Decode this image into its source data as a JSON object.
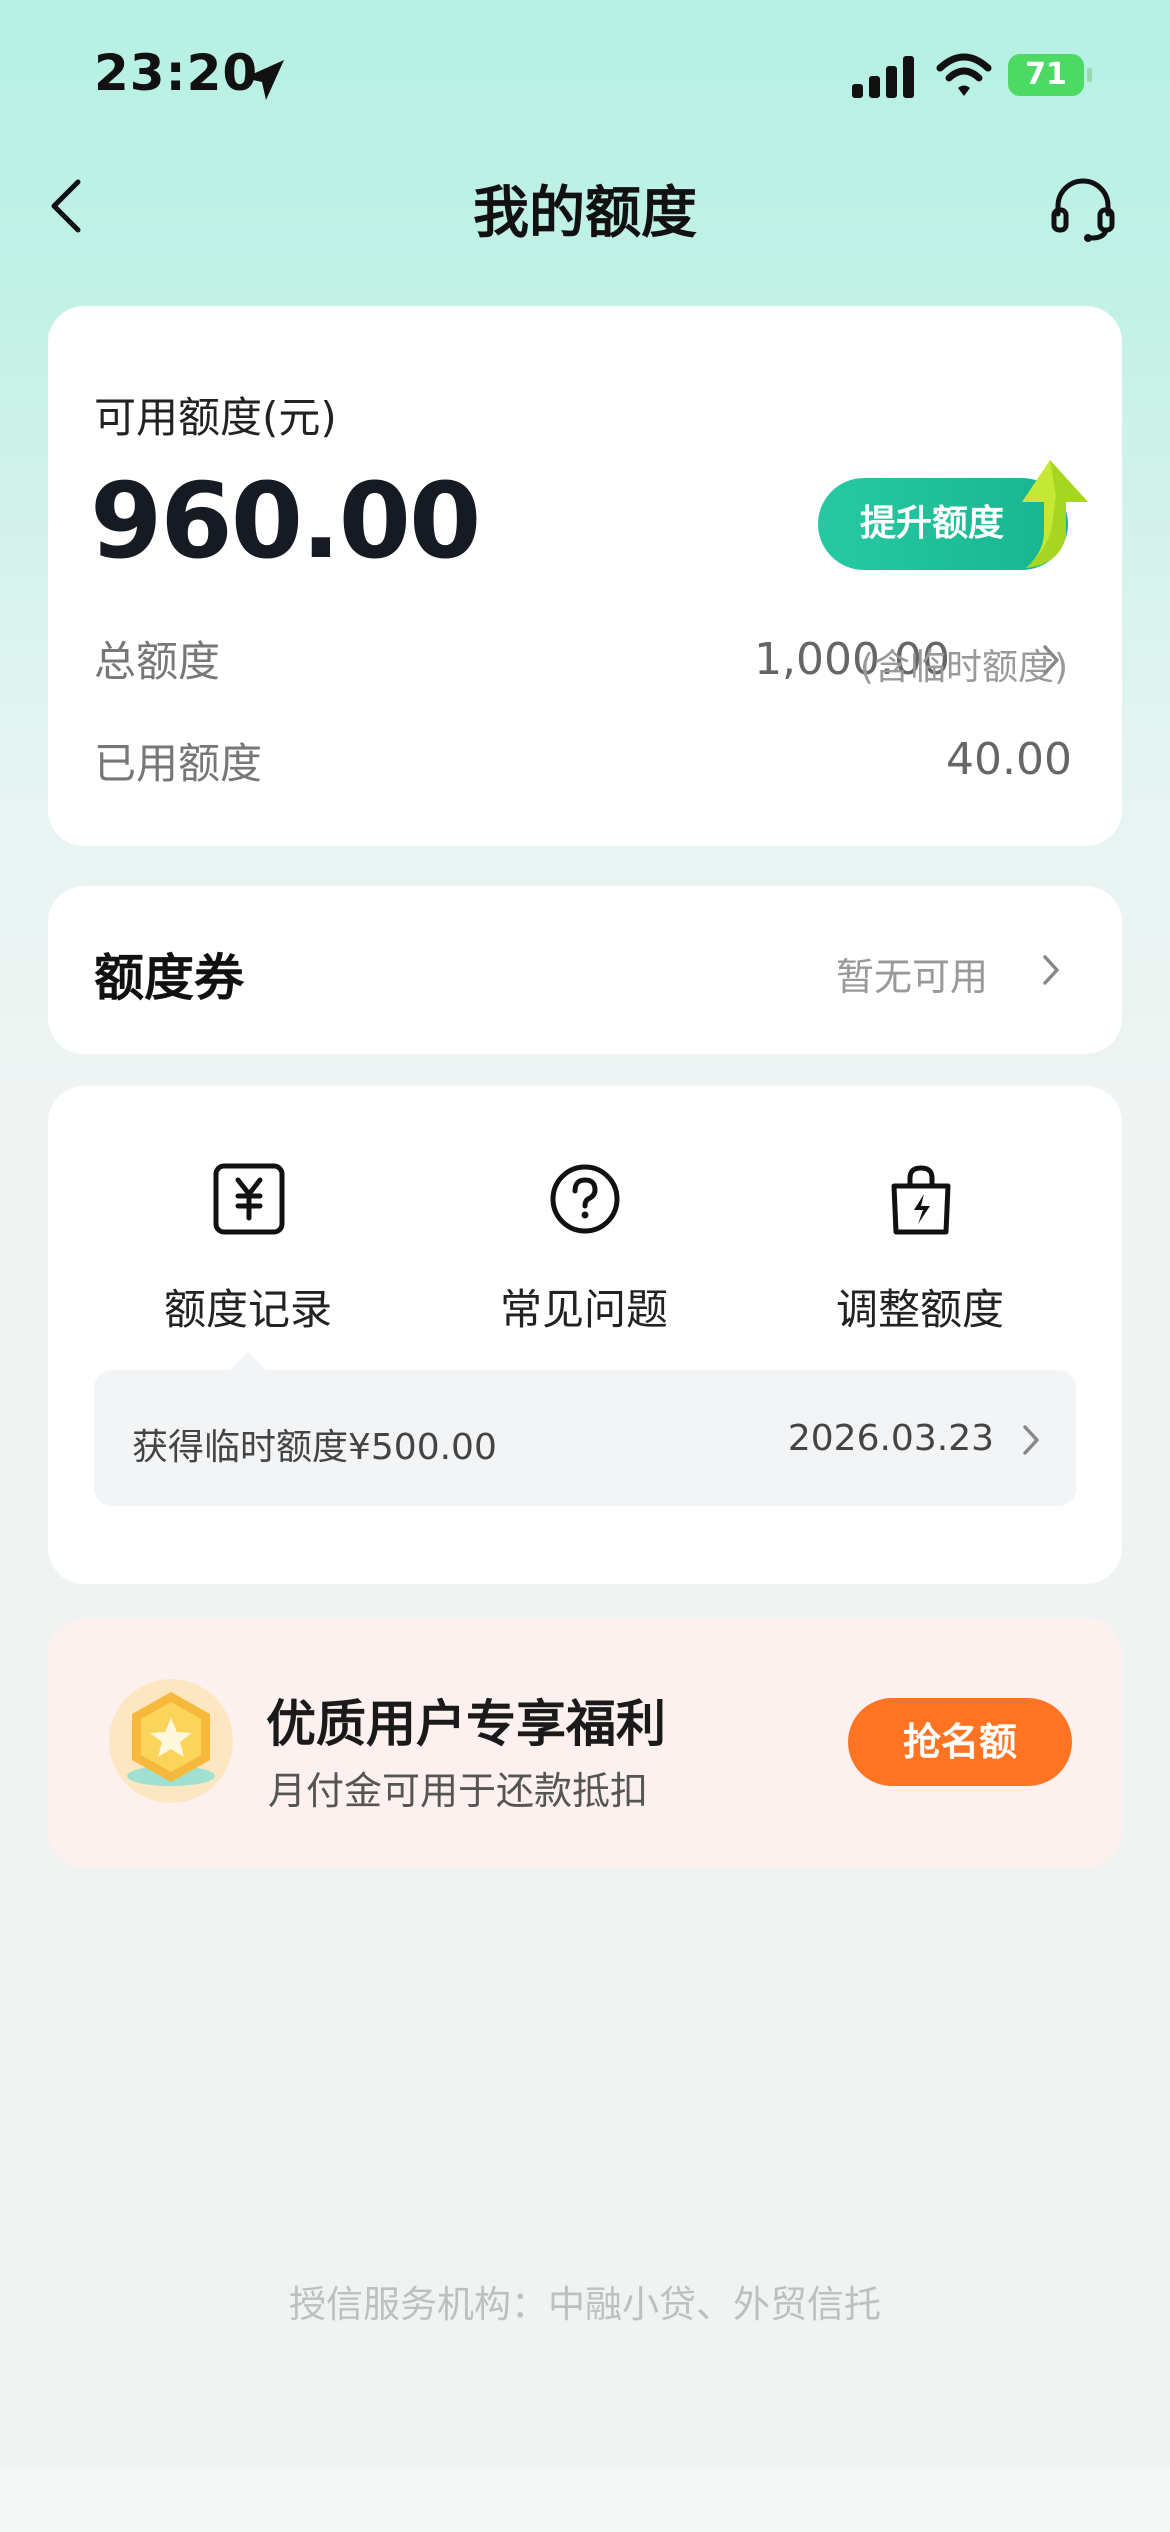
{
  "status_bar": {
    "time": "23:20",
    "battery": "71"
  },
  "nav": {
    "title": "我的额度"
  },
  "quota": {
    "available_label": "可用额度(元)",
    "available_value": "960.00",
    "raise_button": "提升额度",
    "total_label": "总额度",
    "total_value": "1,000.00",
    "total_note": "(含临时额度)",
    "used_label": "已用额度",
    "used_value": "40.00"
  },
  "coupon": {
    "title": "额度券",
    "status": "暂无可用"
  },
  "functions": [
    {
      "label": "额度记录",
      "icon": "yen-receipt-icon"
    },
    {
      "label": "常见问题",
      "icon": "question-circle-icon"
    },
    {
      "label": "调整额度",
      "icon": "bag-lightning-icon"
    }
  ],
  "record": {
    "text": "获得临时额度¥500.00",
    "date": "2026.03.23"
  },
  "promo": {
    "title": "优质用户专享福利",
    "subtitle": "月付金可用于还款抵扣",
    "button": "抢名额"
  },
  "footer": {
    "text": "授信服务机构：中融小贷、外贸信托"
  },
  "colors": {
    "accent": "#1fbf99",
    "promo_button": "#ff7422",
    "promo_bg": "#fdf1ef"
  }
}
